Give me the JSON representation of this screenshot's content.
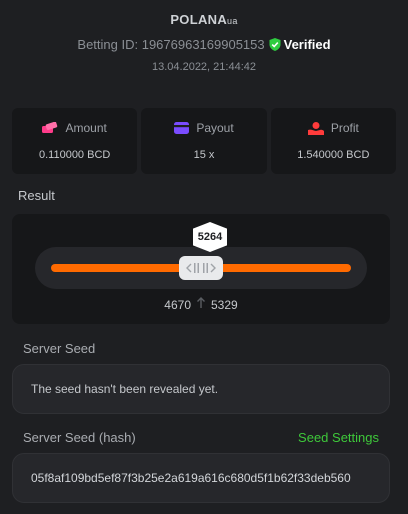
{
  "header": {
    "username": "POLANA",
    "username_suffix": "ua",
    "betting_id": "Betting ID: 19676963169905153",
    "verified_label": "Verified",
    "date": "13.04.2022, 21:44:42"
  },
  "stats": [
    {
      "icon": "coins-icon",
      "label": "Amount",
      "value": "0.110000 BCD",
      "color": "#ff3c8a"
    },
    {
      "icon": "card-icon",
      "label": "Payout",
      "value": "15 x",
      "color": "#7a4cff"
    },
    {
      "icon": "hand-coin-icon",
      "label": "Profit",
      "value": "1.540000 BCD",
      "color": "#ff3b3b"
    }
  ],
  "result": {
    "label": "Result",
    "value": "5264",
    "range_low": "4670",
    "range_high": "5329",
    "accent": "#ff6a00"
  },
  "server_seed": {
    "label": "Server Seed",
    "value": "The seed hasn't been revealed yet."
  },
  "server_seed_hash": {
    "label": "Server Seed (hash)",
    "link": "Seed Settings",
    "value": "05f8af109bd5ef87f3b25e2a619a616c680d5f1b62f33deb560"
  },
  "colors": {
    "verified": "#2ecc40",
    "link": "#3ec83a"
  }
}
